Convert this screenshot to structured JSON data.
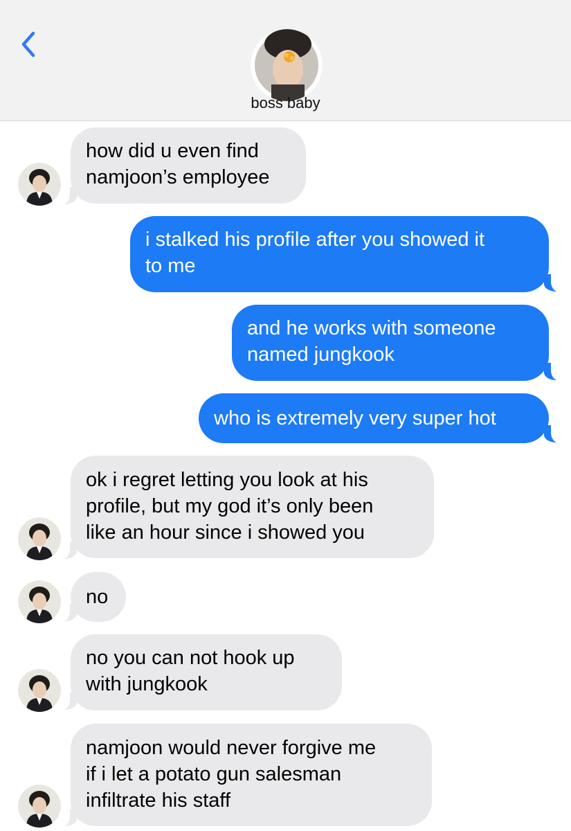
{
  "header": {
    "back_icon": "chevron-left-icon",
    "contact_name": "boss baby",
    "accent": "#3478f6"
  },
  "colors": {
    "incoming_bubble": "#e9e9eb",
    "outgoing_bubble": "#1d7bf5"
  },
  "messages": [
    {
      "direction": "incoming",
      "lines": [
        "how did u even find",
        "namjoon’s employee"
      ]
    },
    {
      "direction": "outgoing",
      "lines": [
        "i stalked his profile after you showed it",
        "to me"
      ]
    },
    {
      "direction": "outgoing",
      "lines": [
        "and he works with someone",
        "named jungkook"
      ]
    },
    {
      "direction": "outgoing",
      "lines": [
        "who is extremely very super hot"
      ]
    },
    {
      "direction": "incoming",
      "lines": [
        "ok i regret letting you look at his",
        "profile, but my god it’s only been",
        "like an hour since i showed you"
      ]
    },
    {
      "direction": "incoming",
      "lines": [
        "no"
      ]
    },
    {
      "direction": "incoming",
      "lines": [
        "no you can not hook up",
        "with jungkook"
      ]
    },
    {
      "direction": "incoming",
      "lines": [
        "namjoon would never forgive me",
        "if i let a potato gun salesman",
        "infiltrate his staff"
      ]
    }
  ]
}
